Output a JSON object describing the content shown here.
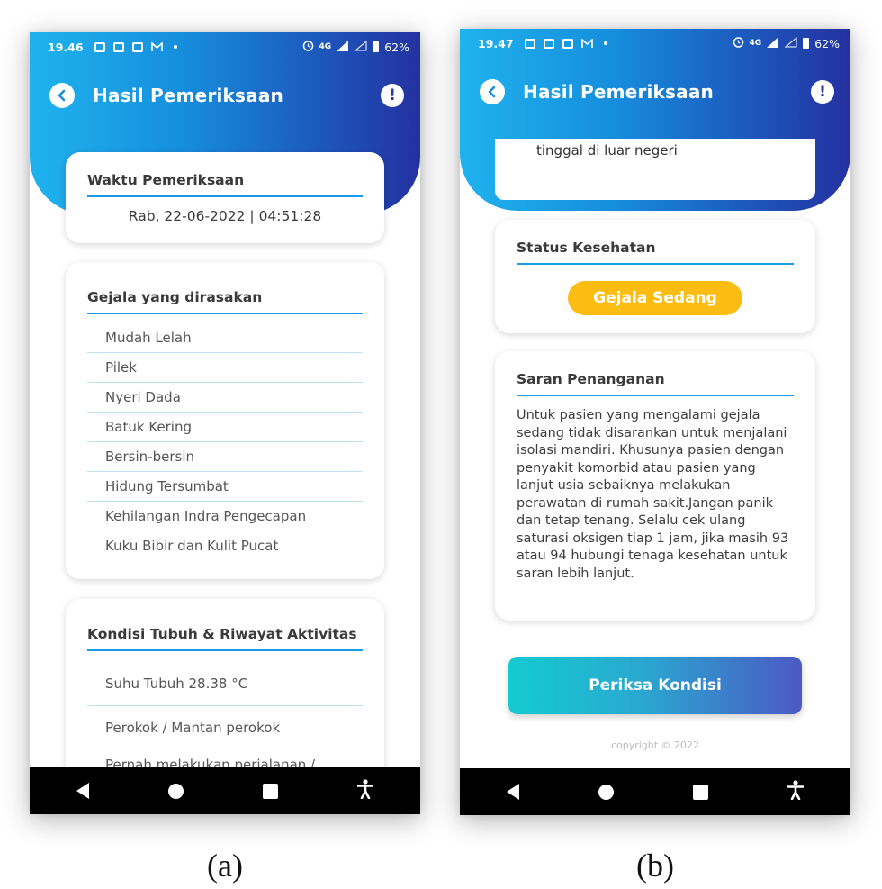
{
  "screen_a": {
    "status": {
      "time": "19.46",
      "network": "4G",
      "battery": "62%"
    },
    "header": {
      "title": "Hasil Pemeriksaan",
      "info": "!"
    },
    "waktu": {
      "title": "Waktu Pemeriksaan",
      "value": "Rab, 22-06-2022 | 04:51:28"
    },
    "gejala": {
      "title": "Gejala yang dirasakan",
      "items": [
        "Mudah Lelah",
        "Pilek",
        "Nyeri Dada",
        "Batuk Kering",
        "Bersin-bersin",
        "Hidung Tersumbat",
        "Kehilangan Indra Pengecapan",
        "Kuku Bibir dan Kulit Pucat"
      ]
    },
    "kondisi": {
      "title": "Kondisi Tubuh & Riwayat Aktivitas",
      "items": [
        "Suhu Tubuh 28.38 °C",
        "Perokok / Mantan perokok",
        "Pernah melakukan perjalanan /"
      ]
    }
  },
  "screen_b": {
    "status": {
      "time": "19.47",
      "network": "4G",
      "battery": "62%"
    },
    "header": {
      "title": "Hasil Pemeriksaan",
      "info": "!"
    },
    "partial_text": "tinggal di luar negeri",
    "status_kesehatan": {
      "title": "Status Kesehatan",
      "badge": "Gejala Sedang",
      "badge_color": "#fbbd12"
    },
    "saran": {
      "title": "Saran Penanganan",
      "text": "Untuk pasien yang mengalami gejala sedang tidak disarankan untuk menjalani isolasi mandiri. Khusunya pasien dengan penyakit komorbid atau pasien yang lanjut usia sebaiknya melakukan perawatan di rumah sakit.Jangan panik dan tetap tenang. Selalu cek ulang saturasi oksigen tiap 1 jam, jika masih 93 atau 94 hubungi tenaga kesehatan untuk saran lebih lanjut."
    },
    "cta": "Periksa Kondisi",
    "copyright": "copyright © 2022"
  },
  "captions": {
    "a": "(a)",
    "b": "(b)"
  },
  "colors": {
    "accent": "#1a9be3",
    "header_start": "#1fb3ee",
    "header_end": "#24319f"
  }
}
